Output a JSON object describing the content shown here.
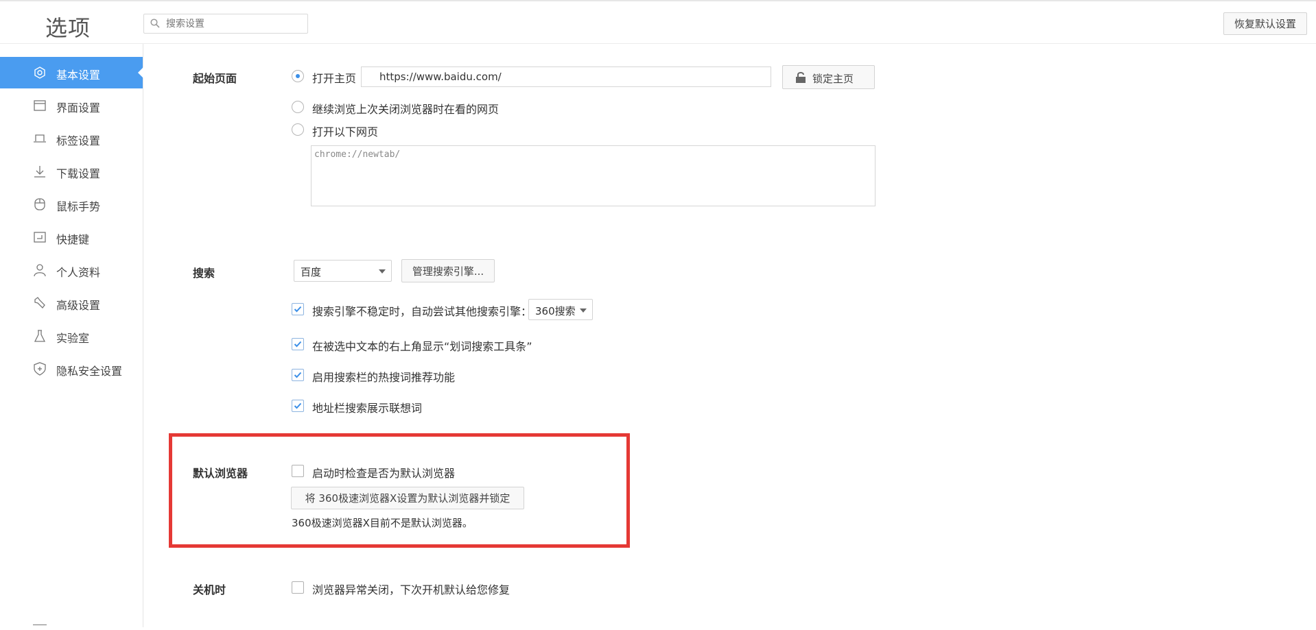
{
  "header": {
    "title": "选项",
    "search_placeholder": "搜索设置",
    "restore_label": "恢复默认设置"
  },
  "sidebar": {
    "items": [
      {
        "label": "基本设置",
        "icon": "settings-gear-icon",
        "active": true
      },
      {
        "label": "界面设置",
        "icon": "window-icon"
      },
      {
        "label": "标签设置",
        "icon": "tab-icon"
      },
      {
        "label": "下载设置",
        "icon": "download-icon"
      },
      {
        "label": "鼠标手势",
        "icon": "mouse-icon"
      },
      {
        "label": "快捷键",
        "icon": "shortcut-icon"
      },
      {
        "label": "个人资料",
        "icon": "user-icon"
      },
      {
        "label": "高级设置",
        "icon": "wrench-icon"
      },
      {
        "label": "实验室",
        "icon": "flask-icon"
      },
      {
        "label": "隐私安全设置",
        "icon": "shield-icon"
      }
    ]
  },
  "startup": {
    "title": "起始页面",
    "open_home_label": "打开主页",
    "home_url": "https://www.baidu.com/",
    "lock_home_label": "锁定主页",
    "continue_label": "继续浏览上次关闭浏览器时在看的网页",
    "open_pages_label": "打开以下网页",
    "pages_text": "chrome://newtab/"
  },
  "search": {
    "title": "搜索",
    "engine": "百度",
    "manage_label": "管理搜索引擎...",
    "fallback_label": "搜索引擎不稳定时，自动尝试其他搜索引擎：",
    "fallback_engine": "360搜索",
    "toolbar_label": "在被选中文本的右上角显示“划词搜索工具条”",
    "hotwords_label": "启用搜索栏的热搜词推荐功能",
    "suggest_label": "地址栏搜索展示联想词"
  },
  "default_browser": {
    "title": "默认浏览器",
    "check_label": "启动时检查是否为默认浏览器",
    "set_default_label": "将 360极速浏览器X设置为默认浏览器并锁定",
    "status": "360极速浏览器X目前不是默认浏览器。",
    "highlight_color": "#e53935"
  },
  "shutdown": {
    "title": "关机时",
    "repair_label": "浏览器异常关闭，下次开机默认给您修复"
  },
  "colors": {
    "accent": "#4a9cf0"
  }
}
